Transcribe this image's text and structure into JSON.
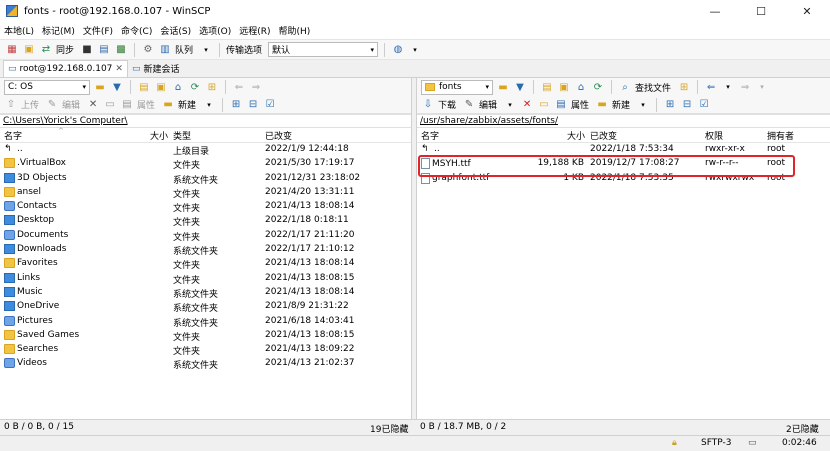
{
  "window": {
    "title": "fonts - root@192.168.0.107 - WinSCP",
    "minimize": "—",
    "maximize": "☐",
    "close": "✕"
  },
  "menu": [
    "本地(L)",
    "标记(M)",
    "文件(F)",
    "命令(C)",
    "会话(S)",
    "选项(O)",
    "远程(R)",
    "帮助(H)"
  ],
  "toolbar": {
    "sync_label": "同步",
    "queue_label": "队列",
    "transfer_label": "传输选项",
    "transfer_value": "默认"
  },
  "tabs": {
    "session_tab": "root@192.168.0.107",
    "new_session": "新建会话"
  },
  "left": {
    "drive": "C: OS",
    "actions": {
      "upload": "上传",
      "edit": "编辑",
      "properties": "属性",
      "new": "新建"
    },
    "path": "C:\\Users\\Yorick's   Computer\\",
    "columns": {
      "name": "名字",
      "size": "大小",
      "type": "类型",
      "changed": "已改变"
    },
    "rows": [
      {
        "name": "..",
        "icon": "up",
        "type": "上级目录",
        "changed": "2022/1/9  12:44:18"
      },
      {
        "name": ".VirtualBox",
        "icon": "folder",
        "type": "文件夹",
        "changed": "2021/5/30  17:19:17"
      },
      {
        "name": "3D Objects",
        "icon": "blue",
        "type": "系统文件夹",
        "changed": "2021/12/31  23:18:02"
      },
      {
        "name": "ansel",
        "icon": "folder",
        "type": "文件夹",
        "changed": "2021/4/20  13:31:11"
      },
      {
        "name": "Contacts",
        "icon": "sys",
        "type": "文件夹",
        "changed": "2021/4/13  18:08:14"
      },
      {
        "name": "Desktop",
        "icon": "blue",
        "type": "文件夹",
        "changed": "2022/1/18  0:18:11"
      },
      {
        "name": "Documents",
        "icon": "sys",
        "type": "文件夹",
        "changed": "2022/1/17  21:11:20"
      },
      {
        "name": "Downloads",
        "icon": "blue",
        "type": "系统文件夹",
        "changed": "2022/1/17  21:10:12"
      },
      {
        "name": "Favorites",
        "icon": "folder",
        "type": "文件夹",
        "changed": "2021/4/13  18:08:14"
      },
      {
        "name": "Links",
        "icon": "blue",
        "type": "文件夹",
        "changed": "2021/4/13  18:08:15"
      },
      {
        "name": "Music",
        "icon": "blue",
        "type": "系统文件夹",
        "changed": "2021/4/13  18:08:14"
      },
      {
        "name": "OneDrive",
        "icon": "blue",
        "type": "系统文件夹",
        "changed": "2021/8/9  21:31:22"
      },
      {
        "name": "Pictures",
        "icon": "sys",
        "type": "系统文件夹",
        "changed": "2021/6/18  14:03:41"
      },
      {
        "name": "Saved Games",
        "icon": "folder",
        "type": "文件夹",
        "changed": "2021/4/13  18:08:15"
      },
      {
        "name": "Searches",
        "icon": "folder",
        "type": "文件夹",
        "changed": "2021/4/13  18:09:22"
      },
      {
        "name": "Videos",
        "icon": "sys",
        "type": "系统文件夹",
        "changed": "2021/4/13  21:02:37"
      }
    ],
    "status": "0 B / 0 B,   0 / 15",
    "hidden": "19已隐藏"
  },
  "right": {
    "folder": "fonts",
    "find_files": "查找文件",
    "actions": {
      "download": "下载",
      "edit": "编辑",
      "properties": "属性",
      "new": "新建"
    },
    "path": "/usr/share/zabbix/assets/fonts/",
    "columns": {
      "name": "名字",
      "size": "大小",
      "changed": "已改变",
      "rights": "权限",
      "owner": "拥有者"
    },
    "rows": [
      {
        "name": "..",
        "icon": "up",
        "size": "",
        "changed": "2022/1/18  7:53:34",
        "rights": "rwxr-xr-x",
        "owner": "root"
      },
      {
        "name": "MSYH.ttf",
        "icon": "file",
        "size": "19,188 KB",
        "changed": "2019/12/7  17:08:27",
        "rights": "rw-r--r--",
        "owner": "root"
      },
      {
        "name": "graphfont.ttf",
        "icon": "file",
        "size": "1 KB",
        "changed": "2022/1/18  7:53:35",
        "rights": "rwxrwxrwx",
        "owner": "root"
      }
    ],
    "status": "0 B / 18.7 MB,   0 / 2",
    "hidden": "2已隐藏"
  },
  "statusbar": {
    "protocol": "SFTP-3",
    "time": "0:02:46"
  }
}
